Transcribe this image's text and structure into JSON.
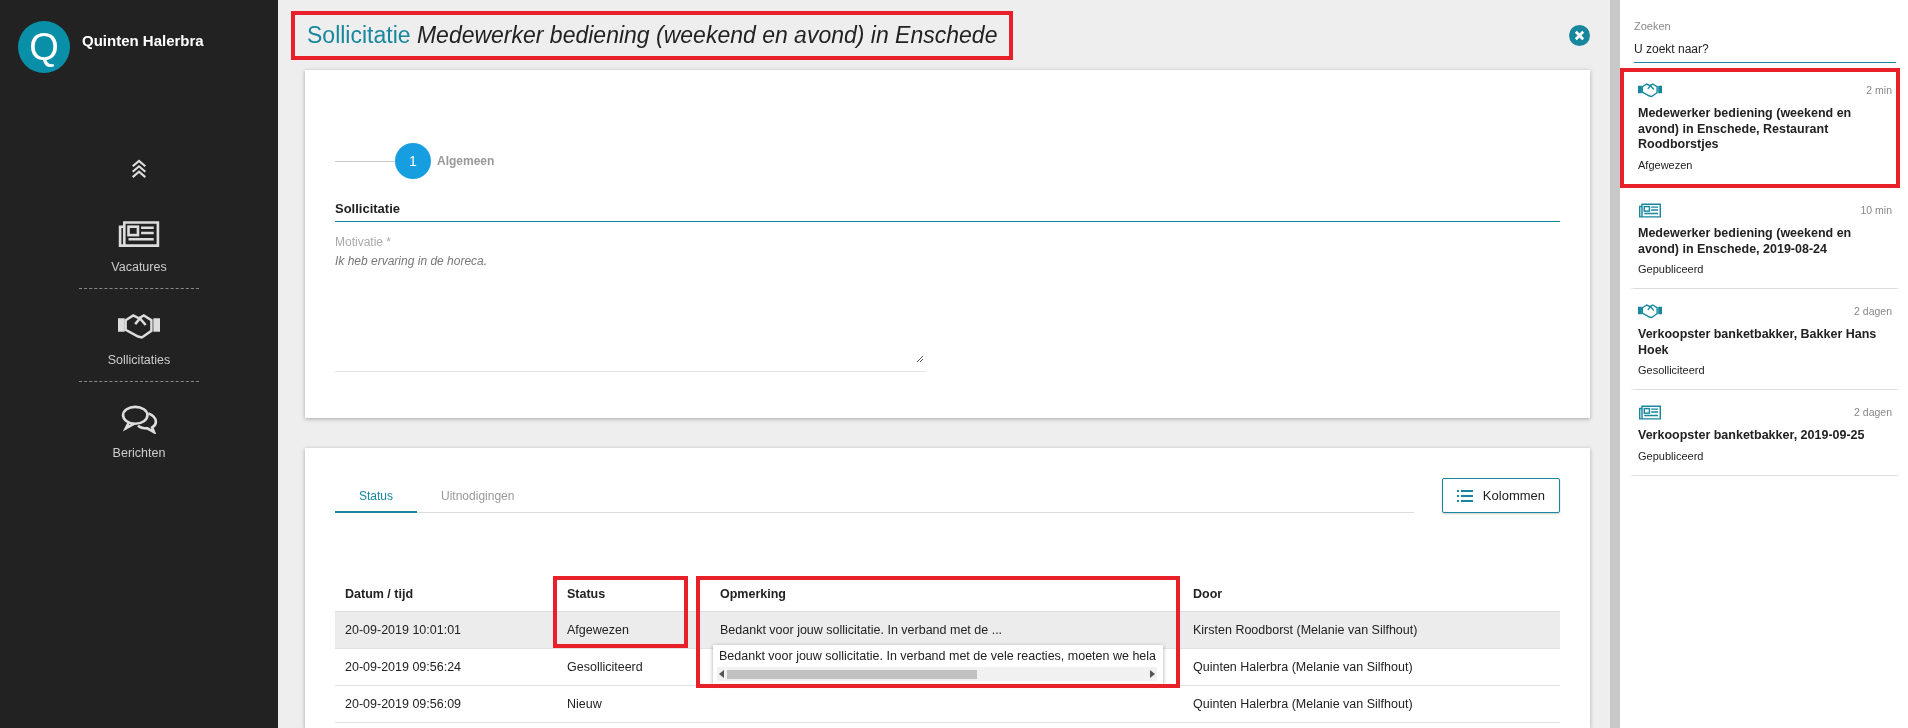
{
  "user": {
    "initial": "Q",
    "name": "Quinten Halerbra"
  },
  "nav": [
    {
      "kind": "newspaper",
      "label": "Vacatures"
    },
    {
      "kind": "handshake",
      "label": "Sollicitaties"
    },
    {
      "kind": "chat",
      "label": "Berichten"
    }
  ],
  "header": {
    "category": "Sollicitatie",
    "title": "Medewerker bediening (weekend en avond) in Enschede",
    "highlighted": true
  },
  "form": {
    "steps": [
      {
        "number": "1",
        "label": "Algemeen",
        "selected": true
      }
    ],
    "section": "Sollicitatie",
    "field": {
      "label": "Motivatie *",
      "value": "Ik heb ervaring in de horeca."
    }
  },
  "tabs": [
    {
      "label": "Status",
      "selected": true
    },
    {
      "label": "Uitnodigingen",
      "selected": false
    }
  ],
  "columns_button": "Kolommen",
  "table": {
    "columns": [
      {
        "label": "Datum / tijd",
        "highlighted": false
      },
      {
        "label": "Status",
        "highlighted": true
      },
      {
        "label": "Opmerking",
        "highlighted": true
      },
      {
        "label": "Door",
        "highlighted": false
      }
    ],
    "rows": [
      {
        "selected": true,
        "cells": [
          "20-09-2019 10:01:01",
          "Afgewezen",
          "Bedankt voor jouw sollicitatie. In verband met de ...",
          "Kirsten Roodborst (Melanie van Silfhout)"
        ],
        "popup": "Bedankt voor jouw sollicitatie. In verband met de vele reacties, moeten we hela"
      },
      {
        "selected": false,
        "cells": [
          "20-09-2019 09:56:24",
          "Gesolliciteerd",
          null,
          "Quinten Halerbra (Melanie van Silfhout)"
        ]
      },
      {
        "selected": false,
        "cells": [
          "20-09-2019 09:56:09",
          "Nieuw",
          null,
          "Quinten Halerbra (Melanie van Silfhout)"
        ]
      }
    ]
  },
  "search": {
    "label": "Zoeken",
    "placeholder": "U zoekt naar?"
  },
  "feed": [
    {
      "kind": "application",
      "time": "2 min",
      "title": "Medewerker bediening (weekend en avond) in Enschede, Restaurant Roodborstjes",
      "status": "Afgewezen",
      "highlighted": true
    },
    {
      "kind": "vacancy",
      "time": "10 min",
      "title": "Medewerker bediening (weekend en avond) in Enschede, 2019-08-24",
      "status": "Gepubliceerd",
      "highlighted": false
    },
    {
      "kind": "application",
      "time": "2 dagen",
      "title": "Verkoopster banketbakker, Bakker Hans Hoek",
      "status": "Gesolliciteerd",
      "highlighted": false
    },
    {
      "kind": "vacancy",
      "time": "2 dagen",
      "title": "Verkoopster banketbakker, 2019-09-25",
      "status": "Gepubliceerd",
      "highlighted": false
    }
  ]
}
